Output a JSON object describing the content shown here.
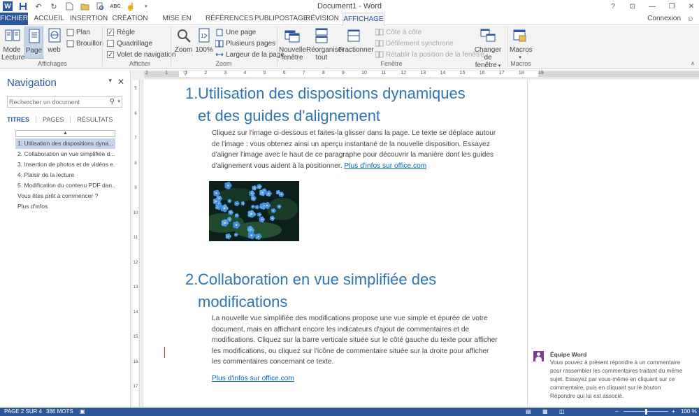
{
  "window": {
    "title": "Document1 - Word",
    "help": "?",
    "ribbon_toggle": "⊡",
    "minimize": "—",
    "restore": "❐",
    "close": "✕"
  },
  "tabs": [
    {
      "label": "FICHIER"
    },
    {
      "label": "ACCUEIL"
    },
    {
      "label": "INSERTION"
    },
    {
      "label": "CRÉATION"
    },
    {
      "label": "MISE EN PAGE"
    },
    {
      "label": "RÉFÉRENCES"
    },
    {
      "label": "PUBLIPOSTAGE"
    },
    {
      "label": "RÉVISION"
    },
    {
      "label": "AFFICHAGE"
    }
  ],
  "account": {
    "label": "Connexion"
  },
  "ribbon": {
    "affichages": {
      "group": "Affichages",
      "mode_lecture": "Mode Lecture",
      "page": "Page",
      "web": "web",
      "plan": "Plan",
      "brouillon": "Brouillon"
    },
    "afficher": {
      "group": "Afficher",
      "regle": "Règle",
      "quadrillage": "Quadrillage",
      "volet": "Volet de navigation"
    },
    "zoom": {
      "group": "Zoom",
      "zoom": "Zoom",
      "cent": "100%",
      "une_page": "Une page",
      "plusieurs": "Plusieurs pages",
      "largeur": "Largeur de la page"
    },
    "fenetre": {
      "group": "Fenêtre",
      "nouvelle_1": "Nouvelle",
      "nouvelle_2": "fenêtre",
      "reorganiser_1": "Réorganiser",
      "reorganiser_2": "tout",
      "fractionner": "Fractionner",
      "cote": "Côte à côte",
      "defilement": "Défilement synchrone",
      "retablir": "Rétablir la position de la fenêtre",
      "changer_1": "Changer de",
      "changer_2": "fenêtre"
    },
    "macros": {
      "group": "Macros",
      "macros": "Macros"
    }
  },
  "navigation": {
    "title": "Navigation",
    "search_placeholder": "Rechercher un document",
    "tabs": [
      "TITRES",
      "PAGES",
      "RÉSULTATS"
    ],
    "headings": [
      "1. Utilisation des dispositions dyna...",
      "2. Collaboration en vue simplifiée d...",
      "3. Insertion de photos et de vidéos e...",
      "4. Plaisir de la lecture",
      "5. Modification du contenu PDF dan...",
      "Vous êtes prêt à commencer ?",
      "Plus d'infos"
    ]
  },
  "ruler": {
    "top": [
      "2",
      "1",
      "1",
      "2",
      "3",
      "4",
      "5",
      "6",
      "7",
      "8",
      "9",
      "10",
      "11",
      "12",
      "13",
      "14",
      "15",
      "16",
      "17",
      "18",
      "19"
    ],
    "left": [
      "5",
      "6",
      "7",
      "8",
      "9",
      "10",
      "11",
      "12",
      "13",
      "14",
      "15",
      "16",
      "17"
    ]
  },
  "document": {
    "h1": {
      "num": "1.",
      "line1": "Utilisation des dispositions dynamiques",
      "line2": "et des guides d'alignement"
    },
    "p1": "Cliquez sur l'image ci-dessous et faites-la glisser dans la page. Le texte se déplace autour de l'image : vous obtenez ainsi un aperçu instantané de la nouvelle disposition. Essayez d'aligner l'image avec le haut de ce paragraphe pour découvrir la manière dont les guides d'alignement vous aident à la positionner. ",
    "p1_link": "Plus d'infos sur office.com",
    "h2": {
      "num": "2.",
      "line1": "Collaboration en vue simplifiée des",
      "line2": "modifications"
    },
    "p2": "La nouvelle vue simplifiée des modifications propose une vue simple et épurée de votre document, mais en affichant encore les indicateurs d'ajout de commentaires et de modifications. Cliquez sur la barre verticale située sur le côté gauche du texte pour afficher les modifications, ou cliquez sur l'icône de commentaire située sur la droite pour afficher les commentaires concernant ce texte.",
    "p2_link": "Plus d'infos sur office.com"
  },
  "comment": {
    "author": "Équipe Word",
    "text": "Vous pouvez à présent répondre à un commentaire pour rassembler les commentaires traitant du même sujet. Essayez par vous-même en cliquant sur ce commentaire, puis en cliquant sur le bouton Répondre qui lui est associé."
  },
  "status": {
    "page": "PAGE 2 SUR 4",
    "words": "386 MOTS",
    "zoom": "100 %",
    "zoom_level": 0.5
  },
  "colors": {
    "accent": "#2b579a",
    "heading": "#2e74b5",
    "link": "#0563c1"
  }
}
